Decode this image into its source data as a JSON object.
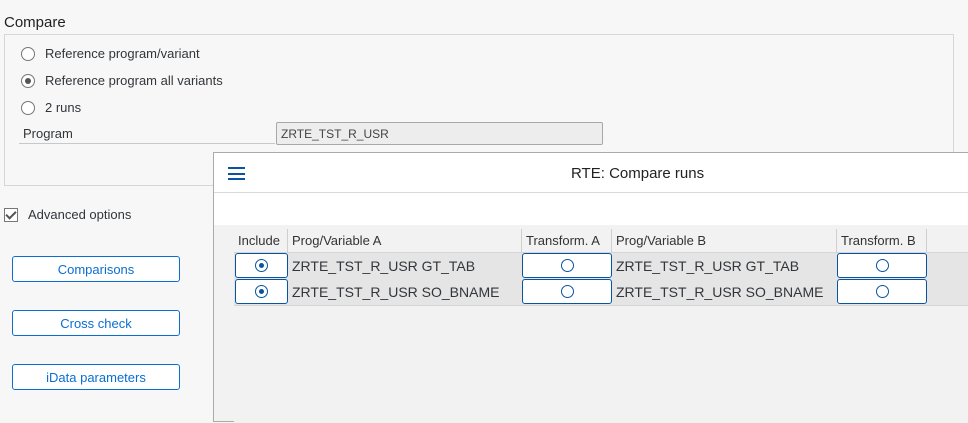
{
  "compare": {
    "title": "Compare",
    "options": [
      {
        "label": "Reference program/variant",
        "checked": false
      },
      {
        "label": "Reference program all variants",
        "checked": true
      },
      {
        "label": "2 runs",
        "checked": false
      }
    ],
    "program_label": "Program",
    "program_value": "ZRTE_TST_R_USR"
  },
  "advanced": {
    "label": "Advanced options",
    "checked": true
  },
  "buttons": {
    "comparisons": "Comparisons",
    "cross_check": "Cross check",
    "idata": "iData parameters"
  },
  "dialog": {
    "title": "RTE: Compare runs",
    "columns": [
      "Include",
      "Prog/Variable A",
      "Transform. A",
      "Prog/Variable B",
      "Transform. B"
    ],
    "rows": [
      {
        "include": true,
        "a": "ZRTE_TST_R_USR GT_TAB",
        "ta": false,
        "b": "ZRTE_TST_R_USR GT_TAB",
        "tb": false
      },
      {
        "include": true,
        "a": "ZRTE_TST_R_USR SO_BNAME",
        "ta": false,
        "b": "ZRTE_TST_R_USR SO_BNAME",
        "tb": false
      }
    ]
  },
  "colors": {
    "accent": "#0854a0",
    "button": "#0a6ed1"
  }
}
